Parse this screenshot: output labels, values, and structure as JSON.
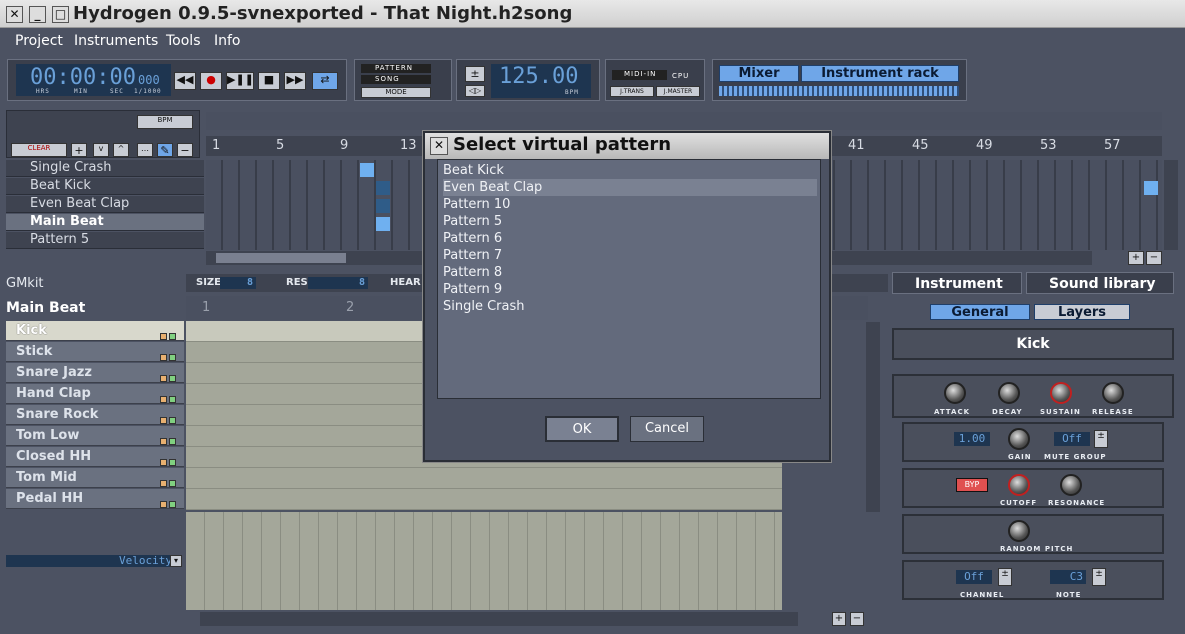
{
  "window": {
    "title": "Hydrogen 0.9.5-svnexported - That Night.h2song",
    "buttons": {
      "close": "✕",
      "minimize": "_",
      "maximize": "□"
    }
  },
  "menu": [
    "Project",
    "Instruments",
    "Tools",
    "Info"
  ],
  "transport": {
    "time": "00:00:00",
    "ms": "000",
    "time_labels": [
      "HRS",
      "MIN",
      "SEC",
      "1/1000"
    ],
    "bpm": "125.00",
    "bpm_label": "BPM"
  },
  "mode": {
    "pattern": "PATTERN",
    "song": "SONG",
    "mode": "MODE"
  },
  "midi": {
    "midi_in": "MIDI-IN",
    "cpu": "CPU",
    "jtrans": "J.TRANS",
    "jmaster": "J.MASTER"
  },
  "toolbar_buttons": {
    "mixer": "Mixer",
    "instrument_rack": "Instrument rack"
  },
  "song_editor": {
    "bpm_btn": "BPM",
    "clear_btn": "CLEAR",
    "ruler": [
      "1",
      "5",
      "9",
      "13",
      "41",
      "45",
      "49",
      "53",
      "57"
    ],
    "patterns": [
      "Single Crash",
      "Beat Kick",
      "Even Beat Clap",
      "Main Beat",
      "Pattern 5"
    ]
  },
  "pattern_editor": {
    "kit": "GMkit",
    "pattern_name": "Main Beat",
    "size_label": "SIZE",
    "size_val": "8",
    "res_label": "RES.",
    "res_val": "8",
    "hear_label": "HEAR",
    "ruler": [
      "1",
      "2"
    ],
    "instruments": [
      "Kick",
      "Stick",
      "Snare Jazz",
      "Hand Clap",
      "Snare Rock",
      "Tom Low",
      "Closed HH",
      "Tom Mid",
      "Pedal HH"
    ],
    "velocity": "Velocity"
  },
  "instrument_panel": {
    "tab_instrument": "Instrument",
    "tab_library": "Sound library",
    "tab_general": "General",
    "tab_layers": "Layers",
    "name": "Kick",
    "adsr": [
      "ATTACK",
      "DECAY",
      "SUSTAIN",
      "RELEASE"
    ],
    "gain_val": "1.00",
    "gain": "GAIN",
    "mute_val": "Off",
    "mute": "MUTE GROUP",
    "byp": "BYP",
    "cutoff": "CUTOFF",
    "resonance": "RESONANCE",
    "random_pitch": "RANDOM PITCH",
    "channel_val": "Off",
    "channel": "CHANNEL",
    "note_val": "C3",
    "note": "NOTE"
  },
  "dialog": {
    "title": "Select virtual pattern",
    "items": [
      "Beat Kick",
      "Even Beat Clap",
      "Pattern 10",
      "Pattern 5",
      "Pattern 6",
      "Pattern 7",
      "Pattern 8",
      "Pattern 9",
      "Single Crash"
    ],
    "selected": "Even Beat Clap",
    "ok": "OK",
    "cancel": "Cancel"
  },
  "colors": {
    "accent": "#6fa6e8",
    "bg": "#4c5262",
    "dark": "#3a3f4c"
  }
}
